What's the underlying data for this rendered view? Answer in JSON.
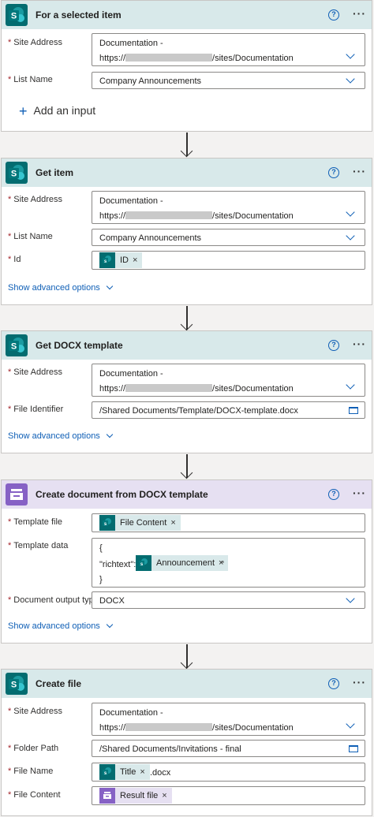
{
  "cards": {
    "trigger": {
      "title": "For a selected item",
      "site_label": "Site Address",
      "site_line1": "Documentation -",
      "site_prefix": "https://",
      "site_suffix": "/sites/Documentation",
      "list_label": "List Name",
      "list_value": "Company Announcements",
      "add_input": "Add an input"
    },
    "get_item": {
      "title": "Get item",
      "site_label": "Site Address",
      "site_line1": "Documentation -",
      "site_prefix": "https://",
      "site_suffix": "/sites/Documentation",
      "list_label": "List Name",
      "list_value": "Company Announcements",
      "id_label": "Id",
      "id_token": "ID",
      "show_advanced": "Show advanced options"
    },
    "get_docx": {
      "title": "Get DOCX template",
      "site_label": "Site Address",
      "site_line1": "Documentation -",
      "site_prefix": "https://",
      "site_suffix": "/sites/Documentation",
      "file_label": "File Identifier",
      "file_value": "/Shared Documents/Template/DOCX-template.docx",
      "show_advanced": "Show advanced options"
    },
    "create_doc": {
      "title": "Create document from DOCX template",
      "template_file_label": "Template file",
      "template_file_token": "File Content",
      "template_data_label": "Template data",
      "data_open": "{",
      "data_key": "\"richtext\":\"",
      "data_token": "Announcement",
      "data_quote": "\"",
      "data_close": "}",
      "output_type_label": "Document output type",
      "output_type_value": "DOCX",
      "show_advanced": "Show advanced options"
    },
    "create_file": {
      "title": "Create file",
      "site_label": "Site Address",
      "site_line1": "Documentation -",
      "site_prefix": "https://",
      "site_suffix": "/sites/Documentation",
      "folder_label": "Folder Path",
      "folder_value": "/Shared Documents/Invitations - final",
      "name_label": "File Name",
      "name_token": "Title",
      "name_suffix": ".docx",
      "content_label": "File Content",
      "content_token": "Result file"
    }
  },
  "common": {
    "required_mark": "*",
    "help_glyph": "?",
    "more_glyph": "···",
    "remove_glyph": "×",
    "plus_glyph": "+",
    "sp_glyph": "S",
    "sp_token_glyph": "s",
    "colors": {
      "sharepoint": "#036c70",
      "plumsail": "#8661c5",
      "link": "#0f5fb6",
      "required": "#a4262c"
    },
    "icons": [
      "sharepoint-icon",
      "plumsail-documents-icon",
      "help-icon",
      "more-options-icon",
      "chevron-down-icon",
      "folder-icon",
      "remove-token-icon",
      "plus-icon",
      "down-arrow-icon"
    ]
  }
}
